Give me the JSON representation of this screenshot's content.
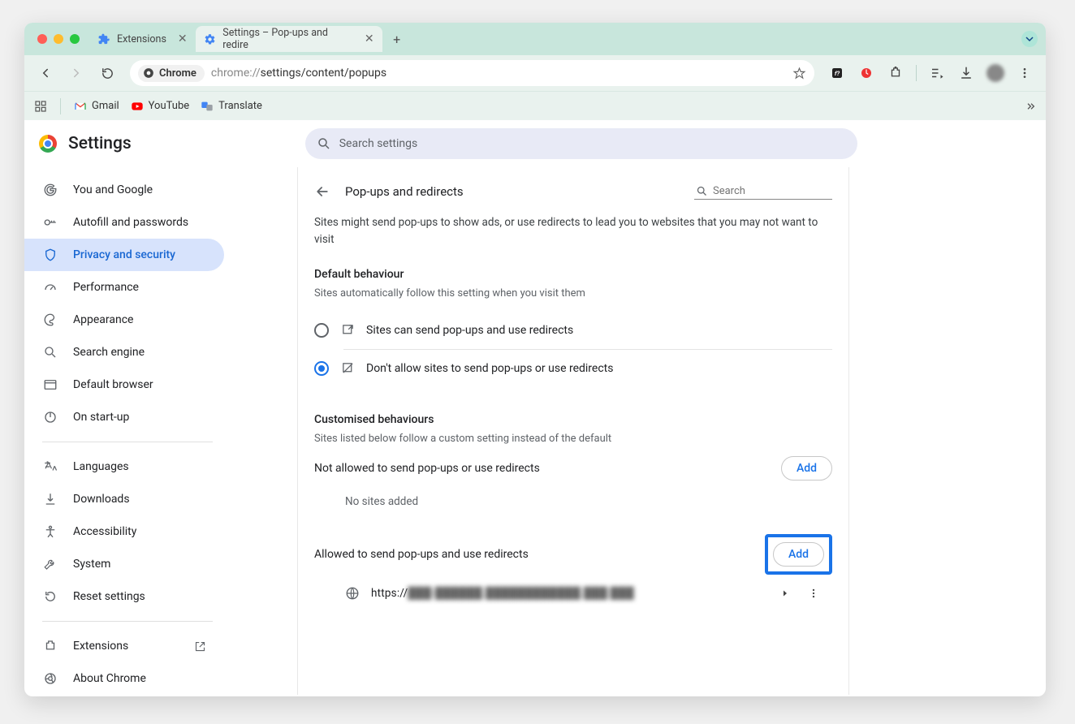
{
  "traffic": {
    "red": "#ff5f57",
    "amber": "#febc2e",
    "green": "#28c840"
  },
  "tabs": [
    {
      "label": "Extensions",
      "active": false
    },
    {
      "label": "Settings – Pop-ups and redire",
      "active": true
    }
  ],
  "toolbar": {
    "chip_label": "Chrome",
    "url_prefix": "chrome://",
    "url_rest": "settings/content/popups"
  },
  "bookmarks": {
    "items": [
      "Gmail",
      "YouTube",
      "Translate"
    ]
  },
  "settings": {
    "title": "Settings",
    "search_placeholder": "Search settings",
    "nav": [
      "You and Google",
      "Autofill and passwords",
      "Privacy and security",
      "Performance",
      "Appearance",
      "Search engine",
      "Default browser",
      "On start-up"
    ],
    "nav2": [
      "Languages",
      "Downloads",
      "Accessibility",
      "System",
      "Reset settings"
    ],
    "nav3": [
      "Extensions",
      "About Chrome"
    ]
  },
  "page": {
    "title": "Pop-ups and redirects",
    "search_placeholder": "Search",
    "intro": "Sites might send pop-ups to show ads, or use redirects to lead you to websites that you may not want to visit",
    "default_h": "Default behaviour",
    "default_s": "Sites automatically follow this setting when you visit them",
    "opt1": "Sites can send pop-ups and use redirects",
    "opt2": "Don't allow sites to send pop-ups or use redirects",
    "custom_h": "Customised behaviours",
    "custom_s": "Sites listed below follow a custom setting instead of the default",
    "not_allowed_h": "Not allowed to send pop-ups or use redirects",
    "no_sites": "No sites added",
    "allowed_h": "Allowed to send pop-ups and use redirects",
    "add": "Add",
    "site_prefix": "https://",
    "site_blurred": "███-██████.████████████.███:███"
  }
}
